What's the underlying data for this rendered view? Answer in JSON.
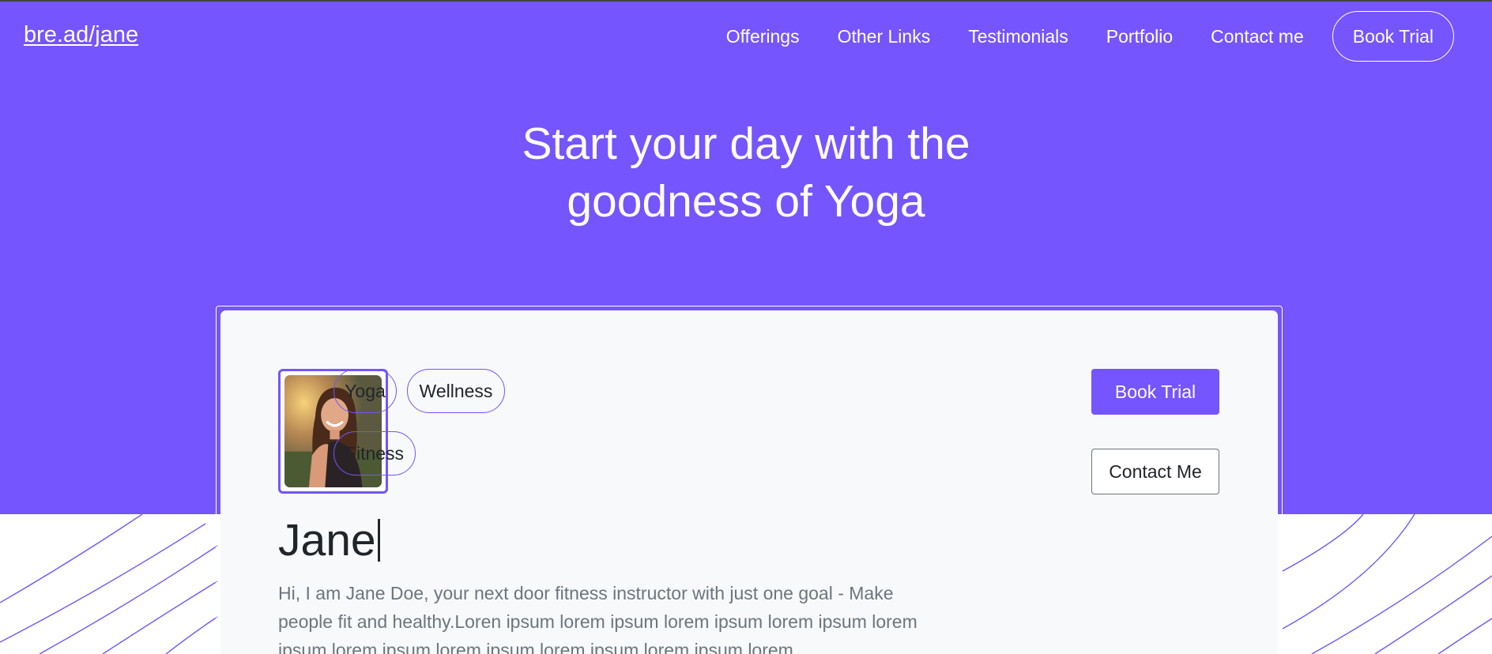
{
  "colors": {
    "brand": "#7455fe",
    "text": "#212529",
    "muted": "#6c757d",
    "card_bg": "#f8f9fa"
  },
  "nav": {
    "logo": "bre.ad/jane",
    "links": [
      "Offerings",
      "Other Links",
      "Testimonials",
      "Portfolio",
      "Contact me"
    ],
    "cta": "Book Trial"
  },
  "hero": {
    "headline_line1": "Start your day with the",
    "headline_line2": "goodness of Yoga"
  },
  "profile": {
    "avatar_icon": "profile-photo",
    "tags": [
      "Yoga",
      "Wellness",
      "Fitness"
    ],
    "name": "Jane",
    "bio": "Hi, I am Jane Doe, your next door fitness instructor with just one goal - Make people fit and healthy.Loren ipsum lorem ipsum lorem ipsum lorem ipsum lorem ipsum lorem ipsum lorem ipsum lorem ipsum lorem ipsum lorem",
    "primary_button": "Book Trial",
    "secondary_button": "Contact Me"
  }
}
